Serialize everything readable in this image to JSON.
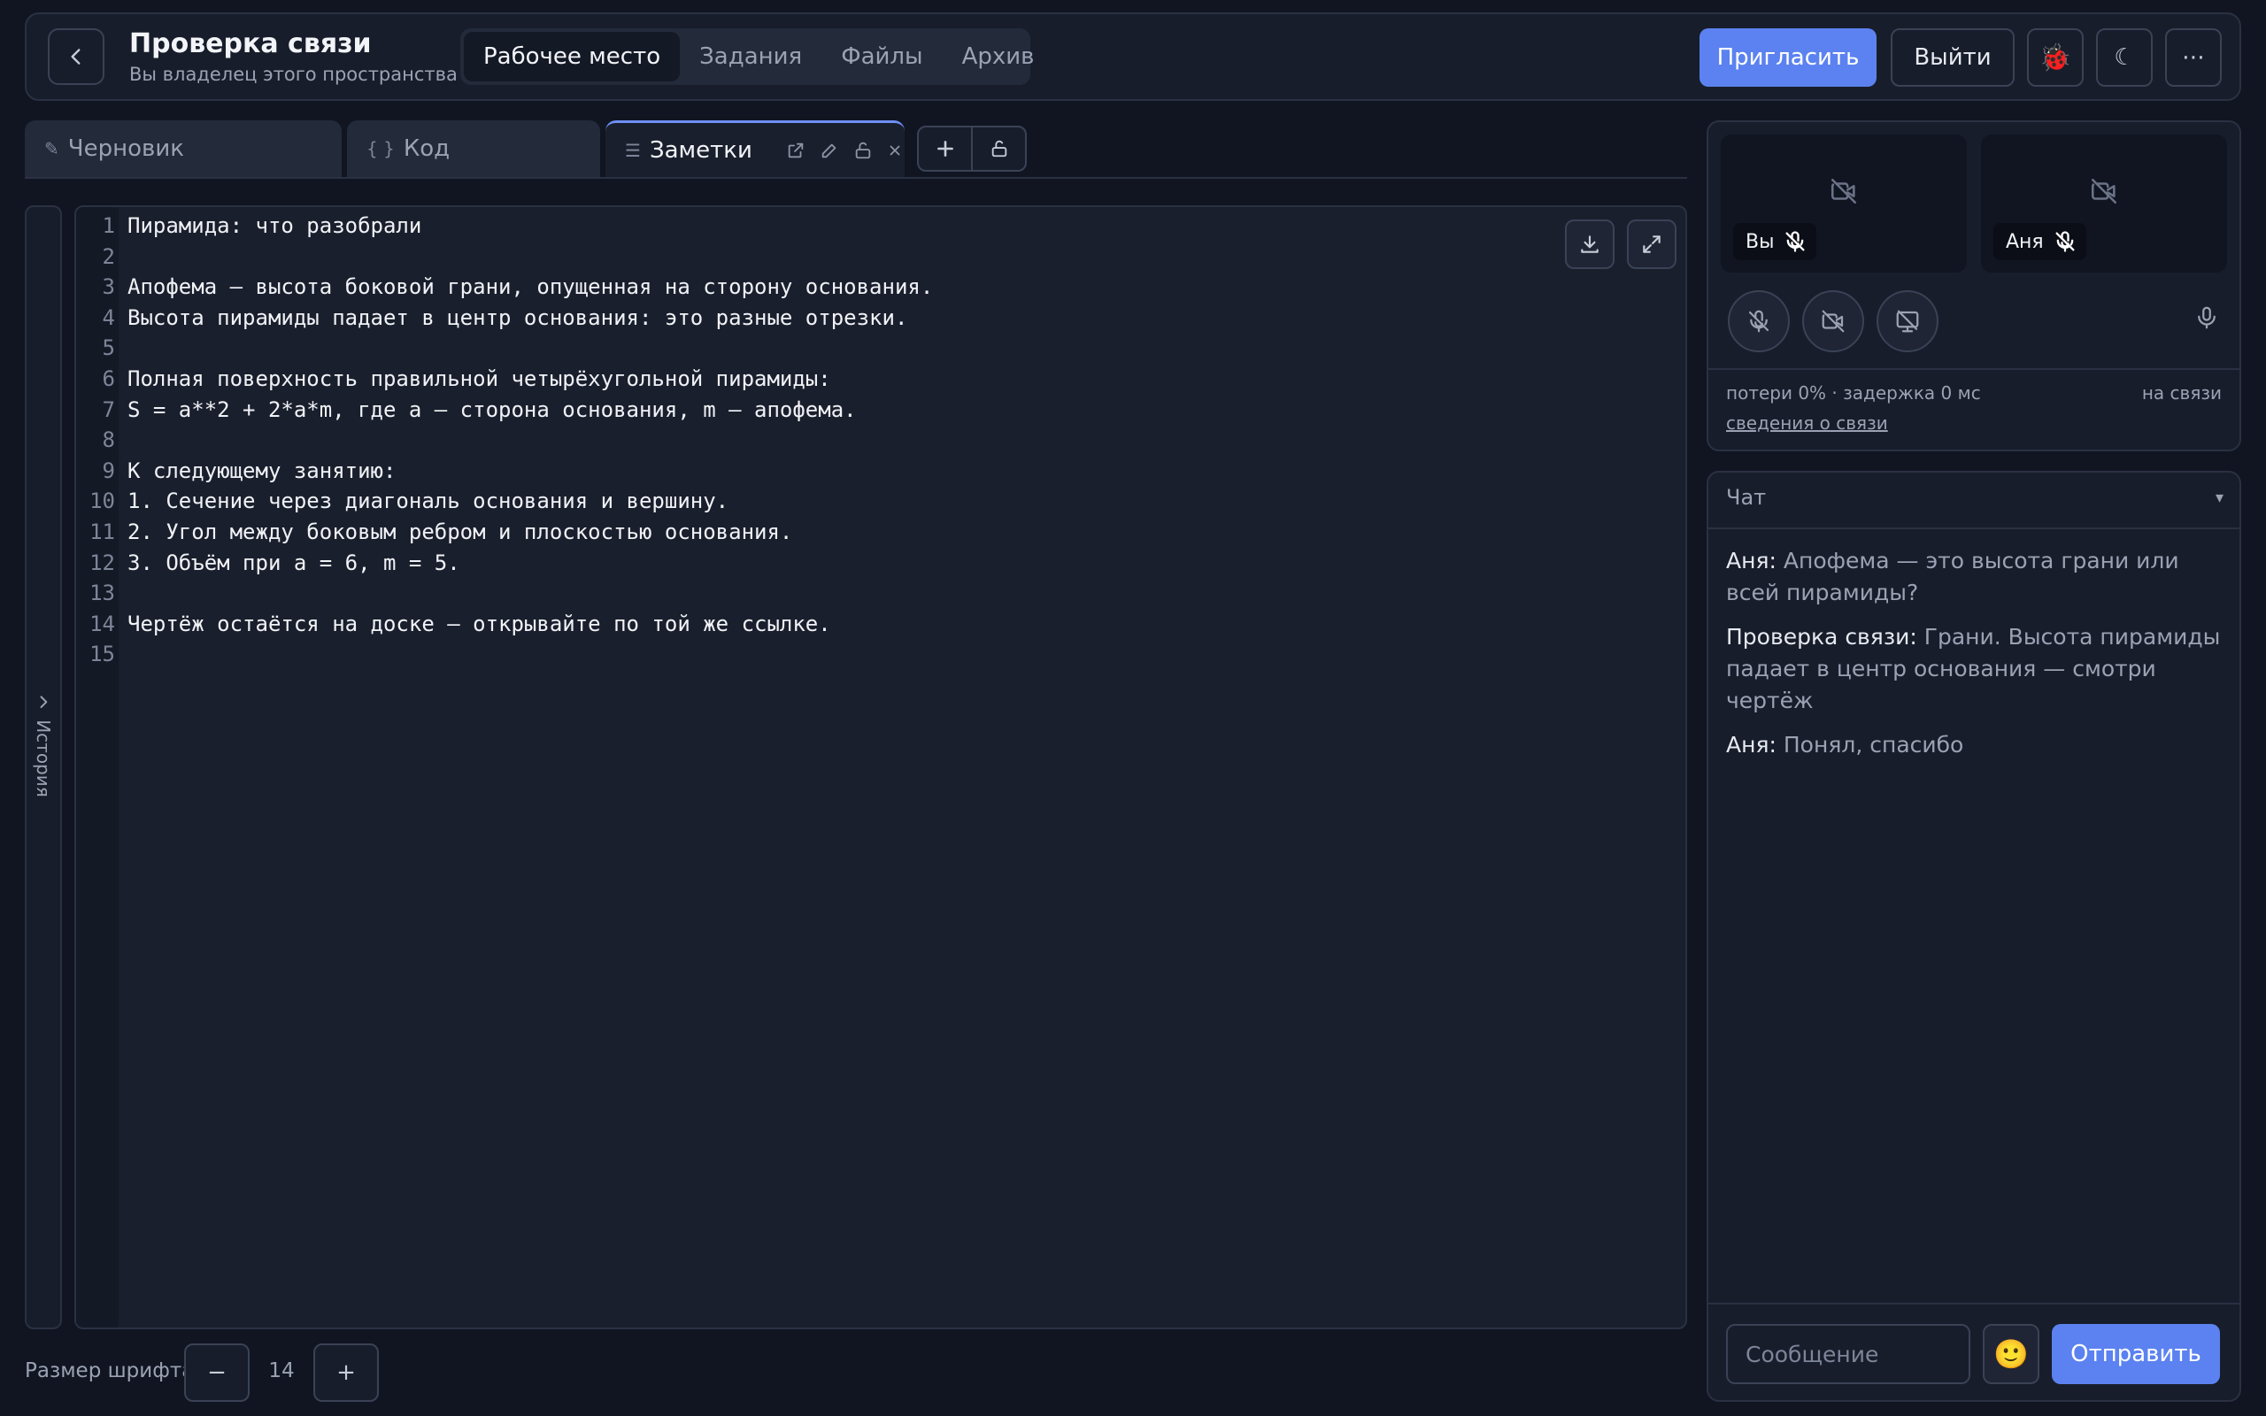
{
  "header": {
    "title": "Проверка связи",
    "subtitle": "Вы владелец этого пространства",
    "nav": [
      {
        "label": "Рабочее место",
        "active": true
      },
      {
        "label": "Задания"
      },
      {
        "label": "Файлы"
      },
      {
        "label": "Архив"
      }
    ],
    "invite_label": "Пригласить",
    "logout_label": "Выйти",
    "bug_icon": "🐞",
    "theme_icon": "☾",
    "more_icon": "⋯"
  },
  "tabs": [
    {
      "icon": "✎",
      "label": "Черновик"
    },
    {
      "icon": "{ }",
      "label": "Код"
    },
    {
      "icon": "☰",
      "label": "Заметки",
      "active": true
    }
  ],
  "history_label": "История",
  "editor": {
    "lines": [
      {
        "n": "1",
        "text": "Пирамида: что разобрали"
      },
      {
        "n": "2",
        "text": ""
      },
      {
        "n": "3",
        "text": "Апофема — высота боковой грани, опущенная на сторону основания."
      },
      {
        "n": "4",
        "text": "Высота пирамиды падает в центр основания: это разные отрезки."
      },
      {
        "n": "5",
        "text": ""
      },
      {
        "n": "6",
        "text": "Полная поверхность правильной четырёхугольной пирамиды:"
      },
      {
        "n": "7",
        "text": "S = a**2 + 2*a*m, где a — сторона основания, m — апофема."
      },
      {
        "n": "8",
        "text": ""
      },
      {
        "n": "9",
        "text": "К следующему занятию:"
      },
      {
        "n": "10",
        "text": "1. Сечение через диагональ основания и вершину."
      },
      {
        "n": "11",
        "text": "2. Угол между боковым ребром и плоскостью основания."
      },
      {
        "n": "12",
        "text": "3. Объём при a = 6, m = 5."
      },
      {
        "n": "13",
        "text": ""
      },
      {
        "n": "14",
        "text": "Чертёж остаётся на доске — открывайте по той же ссылке."
      },
      {
        "n": "15",
        "text": ""
      }
    ]
  },
  "font_size": {
    "label": "Размер шрифта",
    "minus": "−",
    "value": "14",
    "plus": "+"
  },
  "video": {
    "tiles": [
      {
        "name": "Вы"
      },
      {
        "name": "Аня"
      }
    ],
    "stats": "потери 0% · задержка 0 мс",
    "status": "на связи",
    "details_link": "сведения о связи"
  },
  "chat": {
    "title": "Чат",
    "caret": "▾",
    "messages": [
      {
        "author": "Аня:",
        "text": "Апофема — это высота грани или всей пирамиды?"
      },
      {
        "author": "Проверка связи:",
        "text": "Грани. Высота пирамиды падает в центр основания — смотри чертёж"
      },
      {
        "author": "Аня:",
        "text": "Понял, спасибо"
      }
    ],
    "input_placeholder": "Сообщение",
    "emoji": "🙂",
    "send_label": "Отправить"
  },
  "colors": {
    "accent": "#5b82f0",
    "background": "#111522",
    "panel": "#181d2b"
  }
}
